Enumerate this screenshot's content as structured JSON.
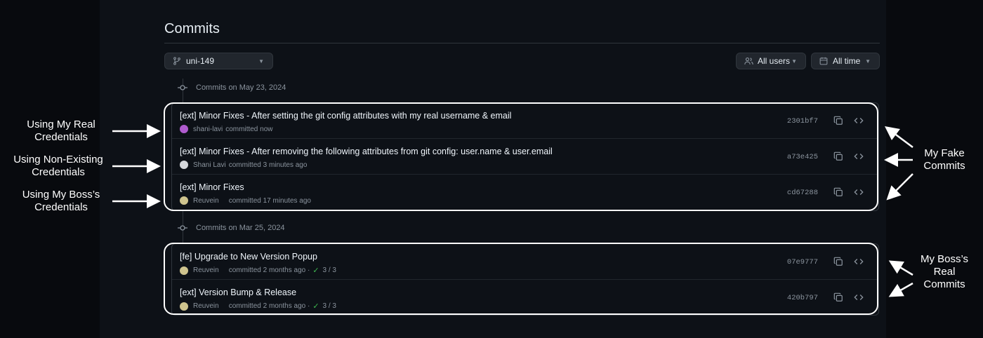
{
  "page": {
    "title": "Commits",
    "branch": "uni-149",
    "users_filter": "All users",
    "time_filter": "All time"
  },
  "groups": [
    {
      "heading": "Commits on May 23, 2024",
      "commits": [
        {
          "message": "[ext] Minor Fixes - After setting the git config attributes with my real username & email",
          "author": "shani-lavi",
          "action": "committed now",
          "checks": "",
          "sha": "2301bf7",
          "avatar_color": "#b05ccf"
        },
        {
          "message": "[ext] Minor Fixes - After removing the following attributes from git config: user.name & user.email",
          "author": "Shani Lavi",
          "action": "committed 3 minutes ago",
          "checks": "",
          "sha": "a73e425",
          "avatar_color": "#d6d8dc"
        },
        {
          "message": "[ext] Minor Fixes",
          "author": "Reuvein",
          "action": "committed 17 minutes ago",
          "checks": "",
          "sha": "cd67288",
          "avatar_color": "#cfc48e"
        }
      ]
    },
    {
      "heading": "Commits on Mar 25, 2024",
      "commits": [
        {
          "message": "[fe] Upgrade to New Version Popup",
          "author": "Reuvein",
          "action": "committed 2 months ago",
          "checks": "3 / 3",
          "sha": "07e9777",
          "avatar_color": "#cfc48e"
        },
        {
          "message": "[ext] Version Bump & Release",
          "author": "Reuvein",
          "action": "committed 2 months ago",
          "checks": "3 / 3",
          "sha": "420b797",
          "avatar_color": "#cfc48e"
        }
      ]
    }
  ],
  "annotations": {
    "real_credentials": "Using My Real Credentials",
    "nonexisting_credentials": "Using Non-Existing Credentials",
    "boss_credentials": "Using My Boss’s Credentials",
    "fake_commits": "My Fake Commits",
    "boss_real_commits": "My Boss’s Real Commits"
  },
  "colors": {
    "background": "#0d1117",
    "success": "#3fb950",
    "annotation": "#ffffff"
  }
}
